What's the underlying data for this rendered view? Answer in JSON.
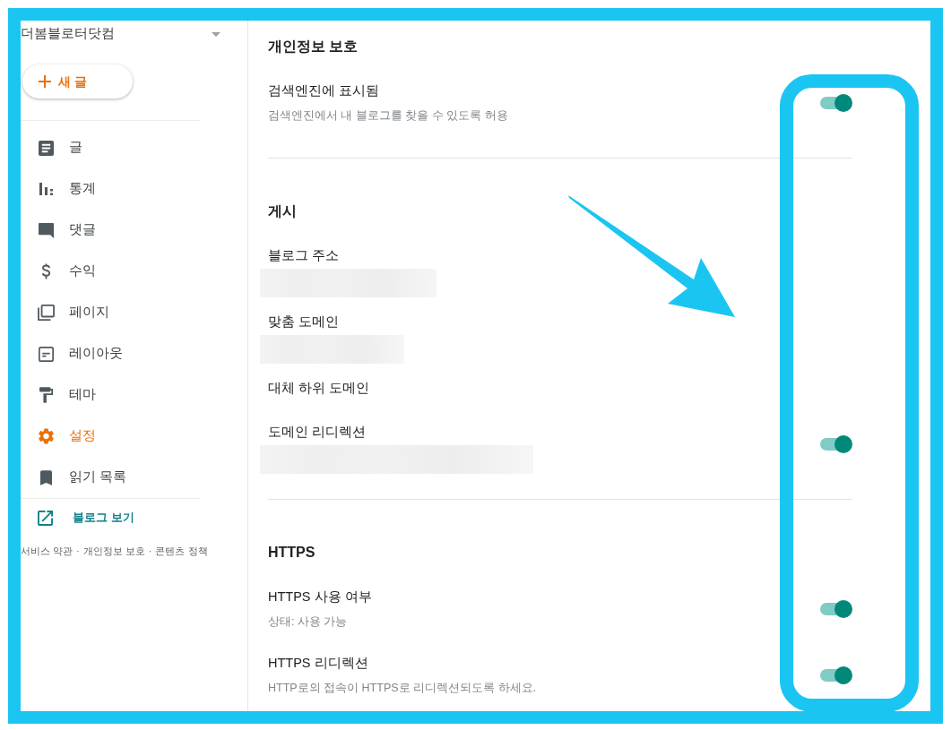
{
  "annotations": [
    {
      "kind": "frame"
    },
    {
      "kind": "arrow"
    },
    {
      "kind": "outline"
    }
  ],
  "sidebar": {
    "blog_title": "더봄블로터닷컴",
    "new_post_button": "새 글",
    "nav_items": [
      {
        "label": "글",
        "selected": false
      },
      {
        "label": "통계",
        "selected": false
      },
      {
        "label": "댓글",
        "selected": false
      },
      {
        "label": "수익",
        "selected": false
      },
      {
        "label": "페이지",
        "selected": false
      },
      {
        "label": "레이아웃",
        "selected": false
      },
      {
        "label": "테마",
        "selected": false
      },
      {
        "label": "설정",
        "selected": true
      },
      {
        "label": "읽기 목록",
        "selected": false
      }
    ],
    "view_blog_link": "블로그 보기",
    "footer_links": [
      "서비스 약관",
      "개인정보 보호",
      "콘텐츠 정책"
    ],
    "footer_separator": "·"
  },
  "settings_page": {
    "sections": [
      {
        "heading": "개인정보 보호",
        "settings": [
          {
            "kind": "switch",
            "title": "검색엔진에 표시됨",
            "description": "검색엔진에서 내 블로그를 찾을 수 있도록 허용",
            "on": true
          }
        ]
      },
      {
        "heading": "게시",
        "settings": [
          {
            "kind": "text",
            "title": "블로그 주소",
            "value_hidden": true
          },
          {
            "kind": "text",
            "title": "맞춤 도메인",
            "value_hidden": true
          },
          {
            "kind": "text",
            "title": "대체 하위 도메인"
          },
          {
            "kind": "switch",
            "title": "도메인 리디렉션",
            "value_hidden": true,
            "on": true
          }
        ]
      },
      {
        "heading": "HTTPS",
        "settings": [
          {
            "kind": "switch",
            "title": "HTTPS 사용 여부",
            "description": "상태: 사용 가능",
            "on": true
          },
          {
            "kind": "switch",
            "title": "HTTPS 리디렉션",
            "description": "HTTP로의 접속이 HTTPS로 리디렉션되도록 하세요.",
            "on": true
          }
        ]
      }
    ]
  }
}
